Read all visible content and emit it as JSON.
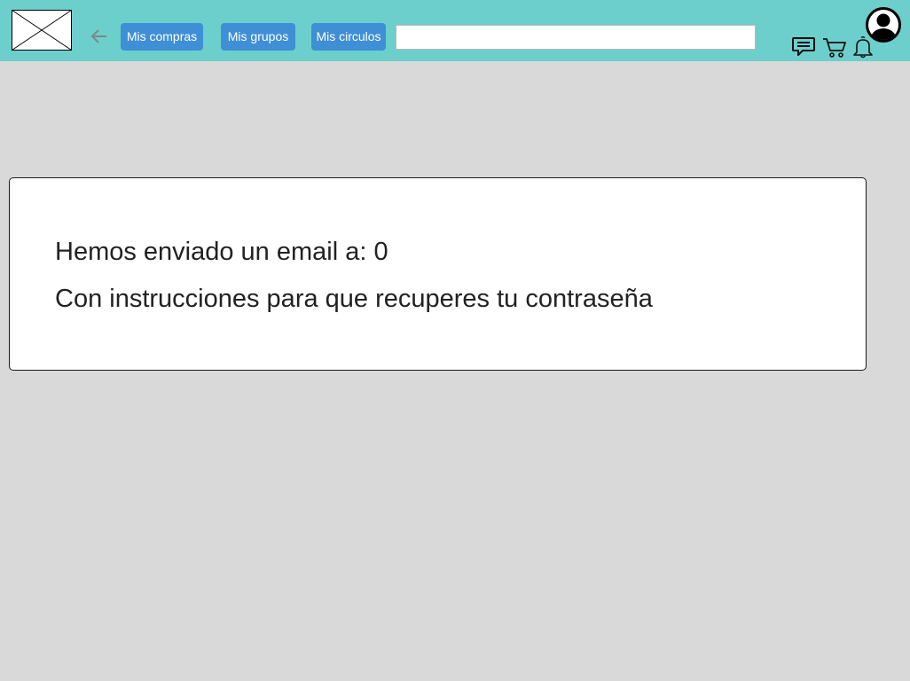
{
  "header": {
    "logo_icon": "image-placeholder-icon",
    "back_icon": "arrow-left-icon",
    "nav": {
      "compras": "Mis compras",
      "grupos": "Mis grupos",
      "circulos": "Mis circulos"
    },
    "search": {
      "value": "",
      "placeholder": ""
    },
    "icons": [
      "chat-icon",
      "cart-icon",
      "bell-icon",
      "avatar-icon"
    ]
  },
  "card": {
    "line1": "Hemos enviado un email a: 0",
    "line2": "Con instrucciones para que recuperes tu contraseña"
  },
  "colors": {
    "header_bg": "#6ccfcc",
    "button_bg": "#3f8fd6",
    "page_bg": "#d9d9d9",
    "card_bg": "#ffffff"
  }
}
